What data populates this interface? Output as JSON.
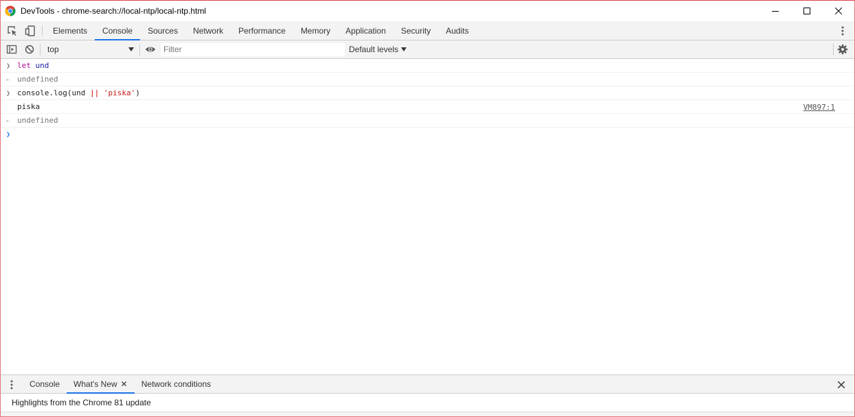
{
  "window": {
    "title": "DevTools - chrome-search://local-ntp/local-ntp.html",
    "controls": [
      "minimize-icon",
      "maximize-icon",
      "close-icon"
    ]
  },
  "main_tabs": [
    {
      "label": "Elements",
      "active": false
    },
    {
      "label": "Console",
      "active": true
    },
    {
      "label": "Sources",
      "active": false
    },
    {
      "label": "Network",
      "active": false
    },
    {
      "label": "Performance",
      "active": false
    },
    {
      "label": "Memory",
      "active": false
    },
    {
      "label": "Application",
      "active": false
    },
    {
      "label": "Security",
      "active": false
    },
    {
      "label": "Audits",
      "active": false
    }
  ],
  "console_toolbar": {
    "context": "top",
    "filter_placeholder": "Filter",
    "filter_value": "",
    "levels": "Default levels"
  },
  "console": {
    "messages": [
      {
        "type": "input",
        "tokens": [
          {
            "text": "let",
            "cls": "kw"
          },
          {
            "text": " ",
            "cls": "plain"
          },
          {
            "text": "und",
            "cls": "var"
          }
        ]
      },
      {
        "type": "result",
        "text": "undefined"
      },
      {
        "type": "input",
        "tokens": [
          {
            "text": "console.log(und ",
            "cls": "plain"
          },
          {
            "text": "||",
            "cls": "op"
          },
          {
            "text": " ",
            "cls": "plain"
          },
          {
            "text": "'piska'",
            "cls": "str"
          },
          {
            "text": ")",
            "cls": "plain"
          }
        ]
      },
      {
        "type": "log",
        "text": "piska",
        "source": "VM897:1"
      },
      {
        "type": "result",
        "text": "undefined"
      }
    ]
  },
  "drawer": {
    "tabs": [
      {
        "label": "Console",
        "active": false,
        "closable": false
      },
      {
        "label": "What's New",
        "active": true,
        "closable": true
      },
      {
        "label": "Network conditions",
        "active": false,
        "closable": false
      }
    ],
    "body_text": "Highlights from the Chrome 81 update"
  },
  "colors": {
    "accent": "#1a73e8",
    "toolbar_bg": "#f3f3f3",
    "border": "#cccccc"
  }
}
